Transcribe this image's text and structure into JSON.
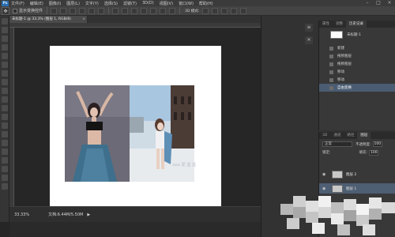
{
  "app": {
    "logo": "Ps",
    "menu": [
      "文件(F)",
      "编辑(E)",
      "图像(I)",
      "图层(L)",
      "文字(Y)",
      "选择(S)",
      "滤镜(T)",
      "3D(D)",
      "视图(V)",
      "窗口(W)",
      "帮助(H)"
    ]
  },
  "options_bar": {
    "auto_select_label": "显示变换控件",
    "mode_3d": "3D 模式:"
  },
  "document": {
    "tab_title": "未标题-1 @ 33.3% (图层 1, RGB/8)",
    "close": "×",
    "watermark": "Ann 爱 溢 溢"
  },
  "status": {
    "zoom": "33.33%",
    "doc_info": "文档:6.44M/5.50M",
    "arrow": "▶"
  },
  "history_panel": {
    "tabs": [
      "属性",
      "调整",
      "历史记录"
    ],
    "snapshot_label": "未标题-1",
    "items": [
      {
        "label": "新建",
        "active": false
      },
      {
        "label": "拖移图层",
        "active": false
      },
      {
        "label": "拖移图层",
        "active": false
      },
      {
        "label": "移动",
        "active": false
      },
      {
        "label": "移动",
        "active": false
      },
      {
        "label": "自由变换",
        "active": true
      }
    ]
  },
  "layers_panel": {
    "tabs": [
      "3D",
      "通道",
      "路径",
      "图层"
    ],
    "blend_mode": "正常",
    "opacity_label": "不透明度:",
    "opacity_value": "100",
    "lock_label": "锁定:",
    "fill_label": "填充:",
    "fill_value": "100",
    "layers": [
      {
        "name": "图层 2",
        "active": false
      },
      {
        "name": "图层 1",
        "active": true
      }
    ]
  },
  "colors": {
    "background": "#262626",
    "panel": "#383838",
    "selection": "#4a5c72"
  }
}
